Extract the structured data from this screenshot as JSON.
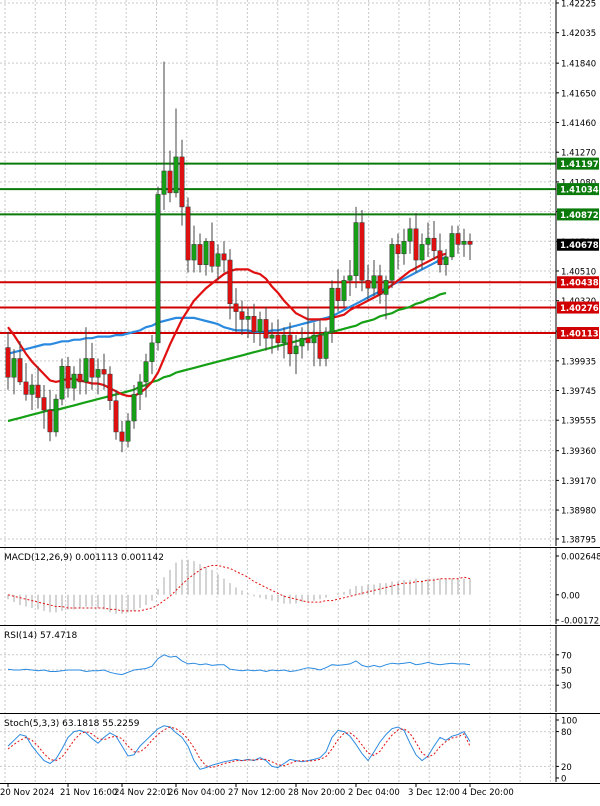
{
  "chart_data": {
    "type": "candlestick",
    "colors": {
      "grid": "#c9c9c9",
      "bull": "#16a016",
      "bear": "#e01010",
      "wick": "#444444",
      "sma_short": "#e01010",
      "sma_mid": "#2a8ae0",
      "sma_long": "#16a016",
      "level_resistance": "#0a7a0a",
      "level_support": "#d00000",
      "current_price_bg": "#000000",
      "macd_hist": "#b8b8b8",
      "macd_signal": "#e01010",
      "rsi": "#2a8ae0",
      "stoch_main": "#2a8ae0",
      "stoch_signal": "#e01010"
    },
    "price_axis": {
      "ylim": [
        1.3875,
        1.42225
      ],
      "ticks": [
        "1.42225",
        "1.42035",
        "1.41840",
        "1.41650",
        "1.41460",
        "1.41270",
        "1.41080",
        "1.40890",
        "1.40700",
        "1.40510",
        "1.40320",
        "1.40125",
        "1.39935",
        "1.39745",
        "1.39555",
        "1.39360",
        "1.39170",
        "1.38980",
        "1.38795"
      ]
    },
    "levels": [
      {
        "price": 1.41197,
        "label": "1.41197",
        "kind": "resistance"
      },
      {
        "price": 1.41034,
        "label": "1.41034",
        "kind": "resistance"
      },
      {
        "price": 1.40872,
        "label": "1.40872",
        "kind": "resistance"
      },
      {
        "price": 1.40438,
        "label": "1.40438",
        "kind": "support"
      },
      {
        "price": 1.40276,
        "label": "1.40276",
        "kind": "support"
      },
      {
        "price": 1.40113,
        "label": "1.40113",
        "kind": "support"
      }
    ],
    "current_price": {
      "price": 1.40678,
      "label": "1.40678"
    },
    "x_ticks": [
      {
        "index": 0,
        "label": "20 Nov 2024"
      },
      {
        "index": 10,
        "label": "21 Nov 16:00"
      },
      {
        "index": 19,
        "label": "24 Nov 22:01"
      },
      {
        "index": 28,
        "label": "26 Nov 04:00"
      },
      {
        "index": 38,
        "label": "27 Nov 12:00"
      },
      {
        "index": 48,
        "label": "28 Nov 20:00"
      },
      {
        "index": 58,
        "label": "2 Dec 04:00"
      },
      {
        "index": 68,
        "label": "3 Dec 12:00"
      },
      {
        "index": 77,
        "label": "4 Dec 20:00"
      }
    ],
    "candles": [
      [
        1.4002,
        1.4012,
        1.3975,
        1.3983
      ],
      [
        1.3983,
        1.4001,
        1.3972,
        1.3995
      ],
      [
        1.3995,
        1.4006,
        1.3978,
        1.398
      ],
      [
        1.398,
        1.3992,
        1.3968,
        1.3972
      ],
      [
        1.3972,
        1.3985,
        1.3962,
        1.3978
      ],
      [
        1.3978,
        1.399,
        1.3963,
        1.397
      ],
      [
        1.397,
        1.3978,
        1.395,
        1.3962
      ],
      [
        1.3962,
        1.3975,
        1.3942,
        1.3948
      ],
      [
        1.3948,
        1.3972,
        1.3945,
        1.3969
      ],
      [
        1.3969,
        1.3995,
        1.3965,
        1.399
      ],
      [
        1.399,
        1.3996,
        1.397,
        1.3976
      ],
      [
        1.3976,
        1.399,
        1.3968,
        1.3985
      ],
      [
        1.3985,
        1.3995,
        1.3972,
        1.398
      ],
      [
        1.398,
        1.4015,
        1.3972,
        1.3995
      ],
      [
        1.3995,
        1.4005,
        1.3975,
        1.3983
      ],
      [
        1.3983,
        1.3995,
        1.3972,
        1.3988
      ],
      [
        1.3988,
        1.3998,
        1.3975,
        1.3985
      ],
      [
        1.3985,
        1.399,
        1.3962,
        1.3968
      ],
      [
        1.3968,
        1.3975,
        1.3943,
        1.3948
      ],
      [
        1.3948,
        1.3955,
        1.3935,
        1.3942
      ],
      [
        1.3942,
        1.396,
        1.3938,
        1.3955
      ],
      [
        1.3955,
        1.3978,
        1.395,
        1.3972
      ],
      [
        1.3972,
        1.3985,
        1.3962,
        1.398
      ],
      [
        1.398,
        1.3998,
        1.397,
        1.3993
      ],
      [
        1.3993,
        1.401,
        1.3985,
        1.4005
      ],
      [
        1.4005,
        1.4105,
        1.4,
        1.41
      ],
      [
        1.41,
        1.4185,
        1.409,
        1.4115
      ],
      [
        1.4115,
        1.4128,
        1.4095,
        1.4101
      ],
      [
        1.4101,
        1.4155,
        1.4098,
        1.4124
      ],
      [
        1.4124,
        1.4135,
        1.408,
        1.4092
      ],
      [
        1.4092,
        1.4098,
        1.405,
        1.4058
      ],
      [
        1.4058,
        1.408,
        1.405,
        1.4068
      ],
      [
        1.4068,
        1.4075,
        1.405,
        1.4055
      ],
      [
        1.4055,
        1.4072,
        1.4048,
        1.407
      ],
      [
        1.407,
        1.4082,
        1.405,
        1.4054
      ],
      [
        1.4054,
        1.4068,
        1.4045,
        1.4062
      ],
      [
        1.4062,
        1.407,
        1.405,
        1.4058
      ],
      [
        1.4058,
        1.4065,
        1.402,
        1.403
      ],
      [
        1.403,
        1.404,
        1.4012,
        1.4025
      ],
      [
        1.4025,
        1.4032,
        1.401,
        1.402
      ],
      [
        1.402,
        1.4028,
        1.4008,
        1.4022
      ],
      [
        1.4022,
        1.403,
        1.4005,
        1.4012
      ],
      [
        1.4012,
        1.4025,
        1.4003,
        1.402
      ],
      [
        1.402,
        1.4028,
        1.4,
        1.4008
      ],
      [
        1.4008,
        1.4018,
        1.3998,
        1.401
      ],
      [
        1.401,
        1.402,
        1.4,
        1.4005
      ],
      [
        1.4005,
        1.4015,
        1.3995,
        1.401
      ],
      [
        1.401,
        1.4018,
        1.399,
        1.3998
      ],
      [
        1.3998,
        1.401,
        1.3985,
        1.4003
      ],
      [
        1.4003,
        1.4015,
        1.3995,
        1.4008
      ],
      [
        1.4008,
        1.4028,
        1.4,
        1.4005
      ],
      [
        1.4005,
        1.4018,
        1.399,
        1.401
      ],
      [
        1.401,
        1.402,
        1.399,
        1.3995
      ],
      [
        1.3995,
        1.4015,
        1.399,
        1.4012
      ],
      [
        1.4012,
        1.4045,
        1.4005,
        1.404
      ],
      [
        1.404,
        1.4052,
        1.4025,
        1.4032
      ],
      [
        1.4032,
        1.4048,
        1.4028,
        1.4045
      ],
      [
        1.4045,
        1.4058,
        1.4035,
        1.4048
      ],
      [
        1.4048,
        1.4092,
        1.404,
        1.4082
      ],
      [
        1.4082,
        1.409,
        1.4038,
        1.4045
      ],
      [
        1.4045,
        1.4055,
        1.4032,
        1.404
      ],
      [
        1.404,
        1.4058,
        1.4035,
        1.4048
      ],
      [
        1.4048,
        1.4055,
        1.403,
        1.4036
      ],
      [
        1.4036,
        1.4048,
        1.402,
        1.4045
      ],
      [
        1.4045,
        1.4072,
        1.404,
        1.4068
      ],
      [
        1.4068,
        1.4075,
        1.4052,
        1.4062
      ],
      [
        1.4062,
        1.4078,
        1.4055,
        1.407
      ],
      [
        1.407,
        1.4085,
        1.4062,
        1.4078
      ],
      [
        1.4078,
        1.4088,
        1.405,
        1.4058
      ],
      [
        1.4058,
        1.4075,
        1.4052,
        1.4068
      ],
      [
        1.4068,
        1.4082,
        1.406,
        1.4072
      ],
      [
        1.4072,
        1.4083,
        1.4058,
        1.4064
      ],
      [
        1.4064,
        1.4075,
        1.405,
        1.4055
      ],
      [
        1.4055,
        1.4065,
        1.4048,
        1.406
      ],
      [
        1.406,
        1.408,
        1.4058,
        1.4075
      ],
      [
        1.4075,
        1.408,
        1.4062,
        1.4068
      ],
      [
        1.4068,
        1.4078,
        1.406,
        1.407
      ],
      [
        1.407,
        1.4075,
        1.4058,
        1.4068
      ]
    ],
    "sma_short": [
      1.4015,
      1.401,
      1.4004,
      1.3998,
      1.3993,
      1.3989,
      1.3985,
      1.3981,
      1.398,
      1.3981,
      1.3982,
      1.3982,
      1.3981,
      1.398,
      1.3979,
      1.3979,
      1.3978,
      1.3976,
      1.3974,
      1.3972,
      1.3971,
      1.3971,
      1.3973,
      1.3976,
      1.398,
      1.3986,
      1.3995,
      1.4004,
      1.4012,
      1.402,
      1.4026,
      1.4032,
      1.4036,
      1.404,
      1.4043,
      1.4046,
      1.4049,
      1.4051,
      1.4052,
      1.4052,
      1.4052,
      1.405,
      1.4049,
      1.4046,
      1.4041,
      1.4037,
      1.4032,
      1.4028,
      1.4024,
      1.4022,
      1.402,
      1.402,
      1.402,
      1.402,
      1.4021,
      1.4022,
      1.4023,
      1.4026,
      1.4028,
      1.403,
      1.4032,
      1.4034,
      1.4036,
      1.4039,
      1.4042,
      1.4045,
      1.4048,
      1.4051,
      1.4053,
      1.4055,
      1.4057,
      1.4059,
      1.4061,
      1.4062
    ],
    "sma_mid": [
      1.3998,
      1.3999,
      1.4,
      1.4001,
      1.4002,
      1.4003,
      1.4004,
      1.4004,
      1.4005,
      1.4006,
      1.4006,
      1.4007,
      1.4007,
      1.4008,
      1.4008,
      1.4009,
      1.4009,
      1.4009,
      1.401,
      1.401,
      1.4011,
      1.4012,
      1.4013,
      1.4015,
      1.4016,
      1.4018,
      1.4019,
      1.402,
      1.4021,
      1.4021,
      1.4021,
      1.4021,
      1.402,
      1.4019,
      1.4018,
      1.4017,
      1.4015,
      1.4014,
      1.4013,
      1.4013,
      1.4013,
      1.4012,
      1.4012,
      1.4012,
      1.4013,
      1.4013,
      1.4014,
      1.4015,
      1.4016,
      1.4017,
      1.4018,
      1.4019,
      1.402,
      1.4021,
      1.4022,
      1.4024,
      1.4026,
      1.4028,
      1.403,
      1.4032,
      1.4034,
      1.4036,
      1.4038,
      1.404,
      1.4042,
      1.4044,
      1.4046,
      1.4048,
      1.405,
      1.4052,
      1.4054,
      1.4056,
      1.4058,
      1.406
    ],
    "sma_long": [
      1.3955,
      1.3956,
      1.3957,
      1.3958,
      1.3959,
      1.396,
      1.3961,
      1.3962,
      1.3962,
      1.3963,
      1.3964,
      1.3965,
      1.3966,
      1.3967,
      1.3968,
      1.3969,
      1.397,
      1.3971,
      1.3972,
      1.3973,
      1.3974,
      1.3975,
      1.3977,
      1.3978,
      1.398,
      1.3981,
      1.3983,
      1.3984,
      1.3986,
      1.3987,
      1.3988,
      1.3989,
      1.399,
      1.3991,
      1.3992,
      1.3993,
      1.3994,
      1.3995,
      1.3996,
      1.3997,
      1.3998,
      1.3999,
      1.4,
      1.4001,
      1.4002,
      1.4003,
      1.4004,
      1.4005,
      1.4006,
      1.4007,
      1.4008,
      1.4009,
      1.401,
      1.4011,
      1.4012,
      1.4013,
      1.4014,
      1.4015,
      1.4016,
      1.4018,
      1.4019,
      1.402,
      1.4022,
      1.4023,
      1.4024,
      1.4026,
      1.4027,
      1.4028,
      1.403,
      1.4031,
      1.4033,
      1.4034,
      1.4036,
      1.4037
    ],
    "macd": {
      "label": "MACD(12,26,9) 0.001113 0.001142",
      "ylim": [
        -0.001721,
        0.002648
      ],
      "ticks": [
        "0.002648",
        "0.00",
        "-0.001721"
      ],
      "histogram": [
        -0.0003,
        -0.0005,
        -0.0007,
        -0.0008,
        -0.0009,
        -0.001,
        -0.0011,
        -0.0012,
        -0.0012,
        -0.0011,
        -0.001,
        -0.001,
        -0.0009,
        -0.0008,
        -0.0008,
        -0.0009,
        -0.001,
        -0.0012,
        -0.0013,
        -0.0013,
        -0.0012,
        -0.0011,
        -0.0009,
        -0.0007,
        -0.0004,
        0.0004,
        0.0012,
        0.0017,
        0.0022,
        0.0024,
        0.0024,
        0.0023,
        0.0021,
        0.0019,
        0.0017,
        0.0014,
        0.0011,
        0.0008,
        0.0005,
        0.0003,
        0.0001,
        -0.0001,
        -0.0002,
        -0.0003,
        -0.0004,
        -0.0005,
        -0.0006,
        -0.0006,
        -0.0006,
        -0.0005,
        -0.0005,
        -0.0004,
        -0.0003,
        -0.0002,
        0.0,
        0.0001,
        0.0002,
        0.0004,
        0.0006,
        0.0006,
        0.0007,
        0.0007,
        0.0008,
        0.0008,
        0.0009,
        0.0009,
        0.001,
        0.001,
        0.0011,
        0.001,
        0.0011,
        0.0011,
        0.0011,
        0.0011,
        0.0011,
        0.0011,
        0.0011,
        0.0011
      ],
      "signal": [
        0.0,
        -0.0001,
        -0.0002,
        -0.0003,
        -0.0004,
        -0.0005,
        -0.0006,
        -0.0007,
        -0.0008,
        -0.0008,
        -0.0009,
        -0.0009,
        -0.0009,
        -0.0009,
        -0.0009,
        -0.0009,
        -0.0009,
        -0.001,
        -0.001,
        -0.0011,
        -0.0011,
        -0.0011,
        -0.0011,
        -0.001,
        -0.0009,
        -0.0007,
        -0.0004,
        -0.0001,
        0.0003,
        0.0007,
        0.0011,
        0.0014,
        0.0017,
        0.0019,
        0.002,
        0.002,
        0.0019,
        0.0018,
        0.0016,
        0.0014,
        0.0012,
        0.0009,
        0.0007,
        0.0005,
        0.0003,
        0.0001,
        -0.0001,
        -0.0002,
        -0.0003,
        -0.0004,
        -0.0005,
        -0.0005,
        -0.0005,
        -0.0004,
        -0.0004,
        -0.0003,
        -0.0002,
        -0.0001,
        0.0,
        0.0001,
        0.0002,
        0.0003,
        0.0004,
        0.0005,
        0.0006,
        0.0007,
        0.0008,
        0.0008,
        0.0009,
        0.0009,
        0.001,
        0.001,
        0.0011,
        0.0011,
        0.0011,
        0.0011,
        0.0012,
        0.0011
      ]
    },
    "rsi": {
      "label": "RSI(14) 57.4718",
      "ylim": [
        0,
        100
      ],
      "ticks": [
        "70",
        "50",
        "30"
      ],
      "values": [
        51,
        50,
        50,
        51,
        50,
        49,
        50,
        48,
        48,
        49,
        50,
        50,
        50,
        48,
        49,
        49,
        50,
        47,
        45,
        44,
        47,
        50,
        51,
        52,
        55,
        65,
        70,
        67,
        68,
        62,
        58,
        59,
        57,
        58,
        56,
        57,
        57,
        51,
        50,
        49,
        50,
        49,
        50,
        48,
        50,
        49,
        50,
        48,
        49,
        51,
        53,
        52,
        50,
        53,
        57,
        56,
        57,
        58,
        62,
        56,
        54,
        56,
        54,
        57,
        59,
        58,
        59,
        60,
        57,
        58,
        60,
        58,
        57,
        58,
        59,
        58,
        58,
        57
      ]
    },
    "stoch": {
      "label": "Stoch(5,3,3) 63.1818 55.2259",
      "ylim": [
        0,
        100
      ],
      "ticks": [
        "100",
        "80",
        "20",
        "0"
      ],
      "main": [
        55,
        65,
        75,
        72,
        55,
        42,
        30,
        25,
        33,
        50,
        70,
        80,
        82,
        78,
        68,
        60,
        70,
        78,
        72,
        55,
        38,
        40,
        55,
        65,
        75,
        85,
        90,
        88,
        78,
        70,
        55,
        30,
        15,
        18,
        22,
        25,
        28,
        30,
        32,
        30,
        32,
        30,
        35,
        30,
        20,
        18,
        25,
        32,
        30,
        28,
        30,
        32,
        35,
        45,
        70,
        82,
        80,
        72,
        58,
        42,
        30,
        45,
        62,
        75,
        85,
        88,
        82,
        60,
        40,
        30,
        38,
        55,
        70,
        65,
        72,
        75,
        80,
        63
      ],
      "signal": [
        50,
        58,
        65,
        70,
        65,
        55,
        42,
        32,
        30,
        36,
        50,
        65,
        76,
        80,
        76,
        68,
        66,
        70,
        72,
        68,
        55,
        45,
        45,
        53,
        65,
        75,
        83,
        88,
        85,
        78,
        67,
        52,
        33,
        21,
        18,
        21,
        25,
        27,
        30,
        30,
        31,
        31,
        32,
        32,
        28,
        23,
        21,
        25,
        29,
        30,
        29,
        30,
        32,
        37,
        50,
        66,
        77,
        78,
        70,
        57,
        43,
        39,
        46,
        61,
        74,
        83,
        85,
        77,
        61,
        43,
        36,
        41,
        54,
        63,
        69,
        71,
        76,
        55
      ]
    }
  }
}
